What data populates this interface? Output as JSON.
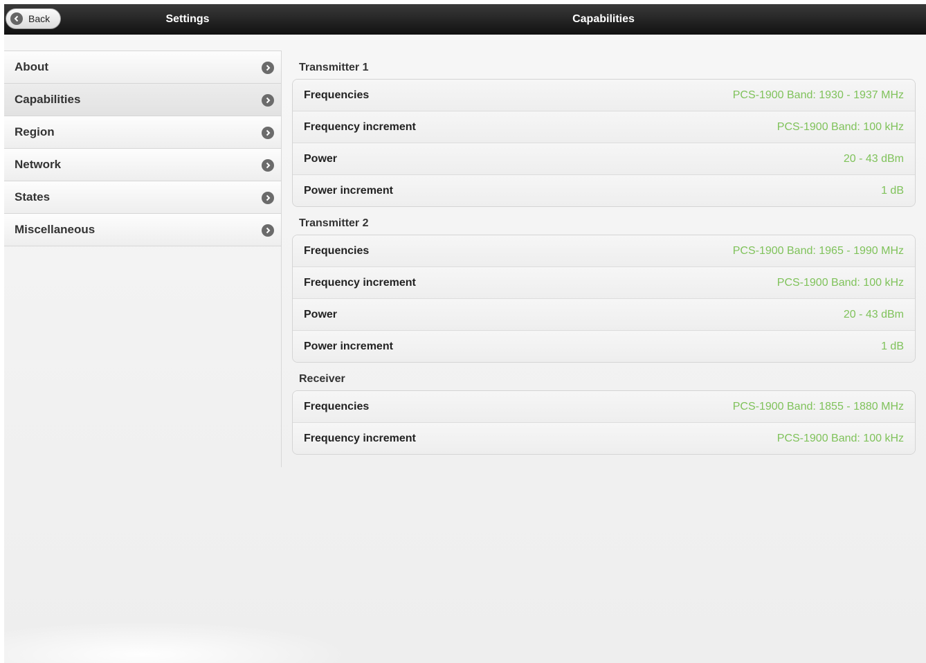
{
  "header": {
    "back_label": "Back",
    "left_title": "Settings",
    "main_title": "Capabilities"
  },
  "sidebar": {
    "items": [
      {
        "label": "About"
      },
      {
        "label": "Capabilities",
        "active": true
      },
      {
        "label": "Region"
      },
      {
        "label": "Network"
      },
      {
        "label": "States"
      },
      {
        "label": "Miscellaneous"
      }
    ]
  },
  "groups": [
    {
      "title": "Transmitter 1",
      "rows": [
        {
          "key": "Frequencies",
          "value": "PCS-1900 Band: 1930 - 1937 MHz"
        },
        {
          "key": "Frequency increment",
          "value": "PCS-1900 Band: 100 kHz"
        },
        {
          "key": "Power",
          "value": "20 - 43 dBm"
        },
        {
          "key": "Power increment",
          "value": "1 dB"
        }
      ]
    },
    {
      "title": "Transmitter 2",
      "rows": [
        {
          "key": "Frequencies",
          "value": "PCS-1900 Band: 1965 - 1990 MHz"
        },
        {
          "key": "Frequency increment",
          "value": "PCS-1900 Band: 100 kHz"
        },
        {
          "key": "Power",
          "value": "20 - 43 dBm"
        },
        {
          "key": "Power increment",
          "value": "1 dB"
        }
      ]
    },
    {
      "title": "Receiver",
      "rows": [
        {
          "key": "Frequencies",
          "value": "PCS-1900 Band: 1855 - 1880 MHz"
        },
        {
          "key": "Frequency increment",
          "value": "PCS-1900 Band: 100 kHz"
        }
      ]
    }
  ],
  "colors": {
    "value_text": "#7fc25a",
    "header_bg": "#1c1c1c"
  },
  "icons": {
    "back": "chevron-left-circle-icon",
    "sidebar_arrow": "chevron-right-circle-icon"
  }
}
